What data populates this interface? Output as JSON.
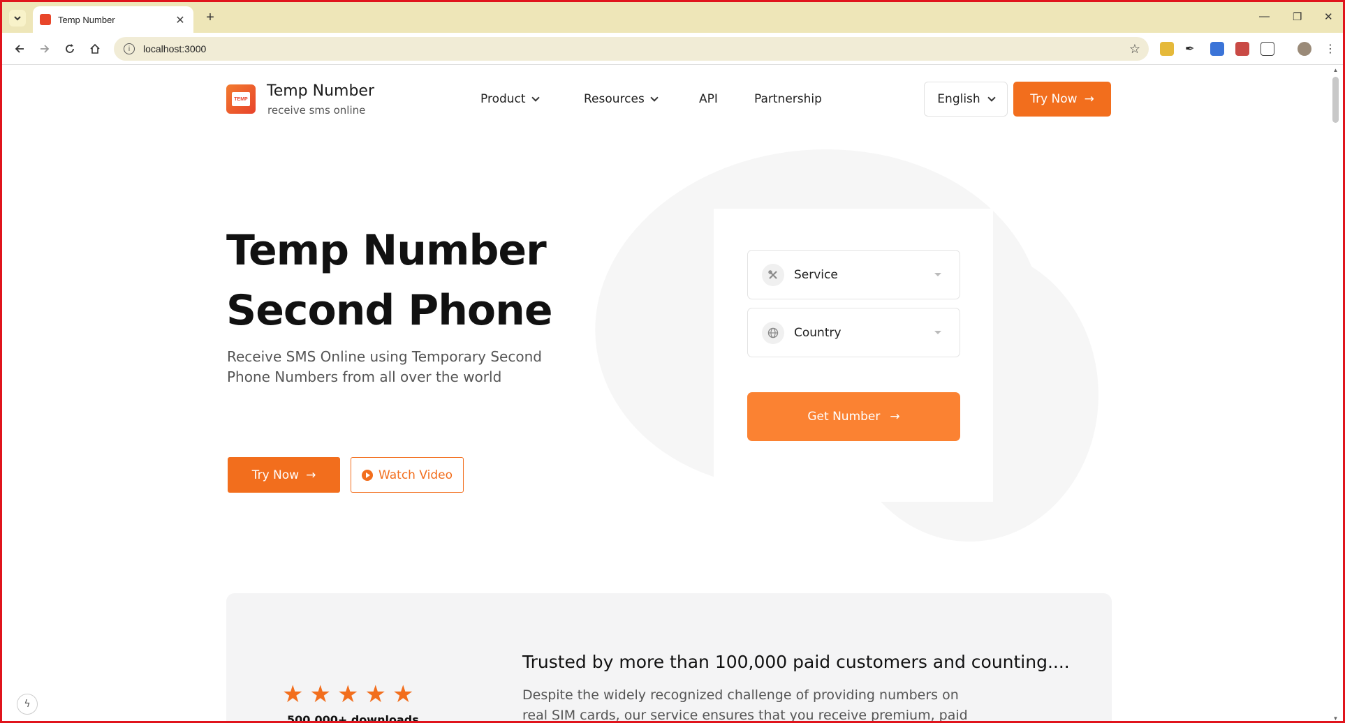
{
  "browser": {
    "tab_title": "Temp Number",
    "tab_close": "✕",
    "new_tab": "+",
    "url": "localhost:3000",
    "win_min": "—",
    "win_restore": "❐",
    "win_close": "✕"
  },
  "header": {
    "brand_name": "Temp Number",
    "brand_tagline": "receive sms online",
    "logo_text": "TEMP",
    "nav": {
      "product": "Product",
      "resources": "Resources",
      "api": "API",
      "partnership": "Partnership"
    },
    "language": "English",
    "try_now": "Try Now"
  },
  "hero": {
    "title_line1": "Temp Number",
    "title_line2": "Second Phone",
    "subtitle": "Receive SMS Online using Temporary Second Phone Numbers from all over the world",
    "try_now": "Try Now",
    "watch_video": "Watch Video"
  },
  "form": {
    "service_label": "Service",
    "country_label": "Country",
    "get_number": "Get Number"
  },
  "trust": {
    "rating_stars": 5,
    "downloads": "500,000+ downloads",
    "title": "Trusted by more than 100,000 paid customers and counting....",
    "body": "Despite the widely recognized challenge of providing numbers on real SIM cards, our service ensures that you receive premium, paid"
  },
  "colors": {
    "accent": "#f26e1d",
    "accent_light": "#fb8232",
    "tabbar": "#eee6b8"
  },
  "icons": [
    "tab-list-icon",
    "favicon",
    "back-icon",
    "forward-icon",
    "reload-icon",
    "home-icon",
    "info-icon",
    "star-icon",
    "chevron-down-icon",
    "arrow-right-icon",
    "play-icon",
    "tools-icon",
    "globe-icon",
    "caret-down-icon",
    "bolt-icon"
  ]
}
